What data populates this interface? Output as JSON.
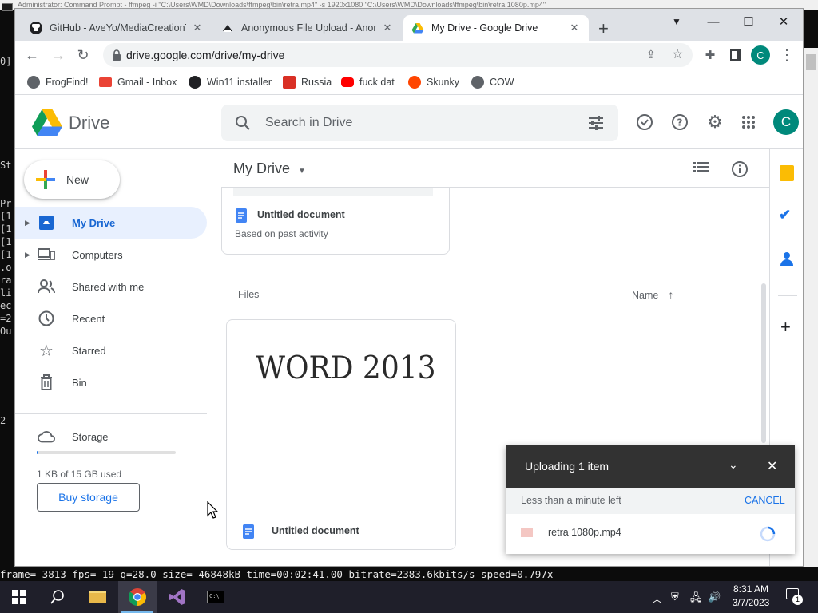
{
  "console": {
    "title": "Administrator: Command Prompt - ffmpeg -i \"C:\\Users\\WMD\\Downloads\\ffmpeg\\bin\\retra.mp4\" -s 1920x1080 \"C:\\Users\\WMD\\Downloads\\ffmpeg\\bin\\retra 1080p.mp4\"",
    "side_fragments": [
      "0]",
      "St",
      "Pr",
      "[1",
      "[1",
      "[1",
      "[1",
      ".o",
      "ra",
      "li",
      "ec",
      "=2",
      "Ou",
      "2-"
    ],
    "ffmpeg_status": "frame= 3813 fps= 19 q=28.0 size=   46848kB time=00:02:41.00 bitrate=2383.6kbits/s speed=0.797x"
  },
  "browser": {
    "tabs": [
      {
        "title": "GitHub - AveYo/MediaCreationTool.bat",
        "active": false
      },
      {
        "title": "Anonymous File Upload - AnonFiles",
        "active": false
      },
      {
        "title": "My Drive - Google Drive",
        "active": true
      }
    ],
    "new_tab_symbol": "+",
    "url": "drive.google.com/drive/my-drive",
    "profile_initial": "C",
    "bookmarks": [
      {
        "label": "FrogFind!",
        "color": "#5f6368"
      },
      {
        "label": "Gmail - Inbox",
        "color": "#ea4335"
      },
      {
        "label": "Win11 installer",
        "color": "#202124"
      },
      {
        "label": "Russia",
        "color": "#d93025"
      },
      {
        "label": "fuck dat",
        "color": "#ff0000"
      },
      {
        "label": "Skunky",
        "color": "#ff4500"
      },
      {
        "label": "COW",
        "color": "#5f6368"
      }
    ]
  },
  "drive": {
    "app_name": "Drive",
    "search_placeholder": "Search in Drive",
    "account_initial": "C",
    "new_button": "New",
    "nav": [
      {
        "label": "My Drive",
        "selected": true,
        "icon": "drive-icon",
        "expandable": true
      },
      {
        "label": "Computers",
        "selected": false,
        "icon": "computers-icon",
        "expandable": true
      },
      {
        "label": "Shared with me",
        "selected": false,
        "icon": "shared-icon",
        "expandable": false
      },
      {
        "label": "Recent",
        "selected": false,
        "icon": "clock-icon",
        "expandable": false
      },
      {
        "label": "Starred",
        "selected": false,
        "icon": "star-icon",
        "expandable": false
      },
      {
        "label": "Bin",
        "selected": false,
        "icon": "bin-icon",
        "expandable": false
      }
    ],
    "storage_label": "Storage",
    "storage_used": "1 KB of 15 GB used",
    "storage_fraction": 0.0001,
    "buy_storage": "Buy storage",
    "location_title": "My Drive",
    "suggested_card": {
      "title": "Untitled document",
      "reason": "Based on past activity"
    },
    "files_heading": "Files",
    "sort_label": "Name",
    "file_card": {
      "thumbnail_text": "WORD 2013",
      "title": "Untitled document"
    },
    "accent": "#1a73e8",
    "avatar_color": "#00897b"
  },
  "upload": {
    "title": "Uploading 1 item",
    "time_left": "Less than a minute left",
    "cancel": "CANCEL",
    "file_name": "retra 1080p.mp4"
  },
  "taskbar": {
    "time": "8:31 AM",
    "date": "3/7/2023",
    "notification_count": "1"
  }
}
